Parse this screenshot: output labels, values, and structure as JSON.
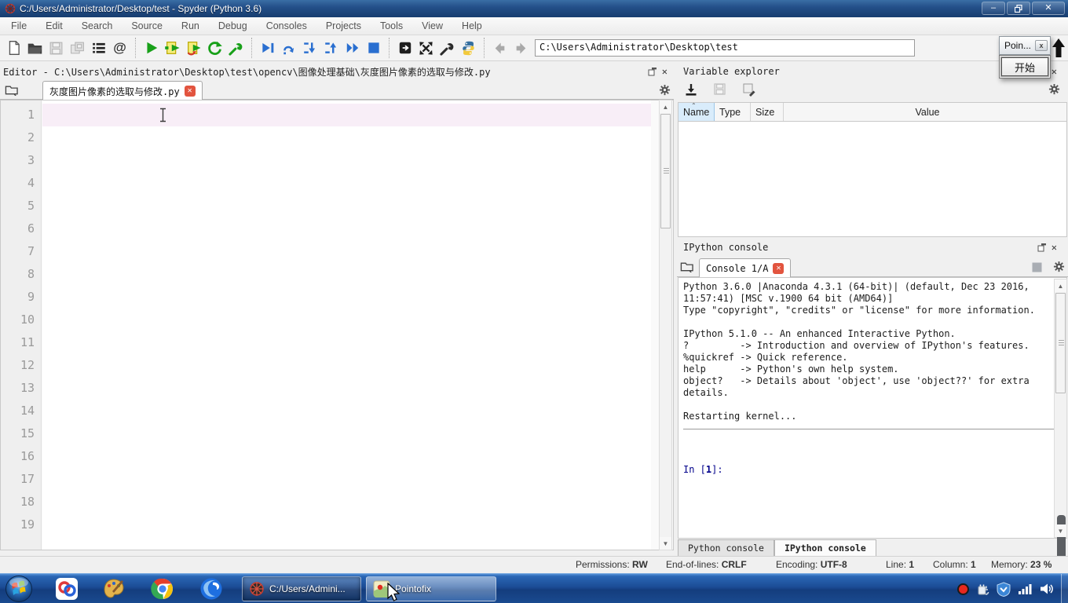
{
  "window": {
    "title": "C:/Users/Administrator/Desktop/test - Spyder (Python 3.6)",
    "controls": {
      "minimize": "–",
      "restore": "❐",
      "close": "✕"
    }
  },
  "menu": {
    "items": [
      "File",
      "Edit",
      "Search",
      "Source",
      "Run",
      "Debug",
      "Consoles",
      "Projects",
      "Tools",
      "View",
      "Help"
    ]
  },
  "toolbar": {
    "address": "C:\\Users\\Administrator\\Desktop\\test",
    "at_glyph": "@"
  },
  "pointofix": {
    "title": "Poin...",
    "close_glyph": "x",
    "start_label": "开始"
  },
  "editor": {
    "pane_title": "Editor - C:\\Users\\Administrator\\Desktop\\test\\opencv\\图像处理基础\\灰度图片像素的选取与修改.py",
    "tab_label": "灰度图片像素的选取与修改.py",
    "tab_close_glyph": "✕",
    "line_numbers": [
      "1",
      "2",
      "3",
      "4",
      "5",
      "6",
      "7",
      "8",
      "9",
      "10",
      "11",
      "12",
      "13",
      "14",
      "15",
      "16",
      "17",
      "18",
      "19"
    ],
    "current_line": "1"
  },
  "variable_explorer": {
    "pane_title": "Variable explorer",
    "columns": [
      "Name",
      "Type",
      "Size",
      "Value"
    ]
  },
  "console": {
    "pane_title": "IPython console",
    "tab_label": "Console 1/A",
    "tab_close_glyph": "✕",
    "banner_lines": [
      "Python 3.6.0 |Anaconda 4.3.1 (64-bit)| (default, Dec 23 2016,",
      "11:57:41) [MSC v.1900 64 bit (AMD64)]",
      "Type \"copyright\", \"credits\" or \"license\" for more information.",
      "",
      "IPython 5.1.0 -- An enhanced Interactive Python.",
      "?         -> Introduction and overview of IPython's features.",
      "%quickref -> Quick reference.",
      "help      -> Python's own help system.",
      "object?   -> Details about 'object', use 'object??' for extra",
      "details.",
      "",
      "Restarting kernel..."
    ],
    "prompt": {
      "prefix": "In [",
      "number": "1",
      "suffix": "]:"
    },
    "bottom_tabs": {
      "python": "Python console",
      "ipython": "IPython console"
    }
  },
  "statusbar": {
    "permissions": {
      "label": "Permissions:",
      "value": "RW"
    },
    "eol": {
      "label": "End-of-lines:",
      "value": "CRLF"
    },
    "encoding": {
      "label": "Encoding:",
      "value": "UTF-8"
    },
    "line": {
      "label": "Line:",
      "value": "1"
    },
    "column": {
      "label": "Column:",
      "value": "1"
    },
    "memory": {
      "label": "Memory:",
      "value": "23 %"
    }
  },
  "taskbar": {
    "spyder_button_label": "C:/Users/Admini...",
    "pointofix_button_label": "Pointofix"
  },
  "icons": {
    "new-file": "blank page",
    "open-file": "folder",
    "save": "floppy (disabled)",
    "save-all": "floppies (disabled)",
    "outline": "list",
    "at-symbol": "@",
    "run": "green play",
    "run-cell": "yellow cell play",
    "run-cell-advance": "cell play advance",
    "rerun": "green circular arrow",
    "configure": "green wrench",
    "debug": "blue play-pause",
    "step": "blue step",
    "step-into": "blue arrow down",
    "step-return": "blue arrow up",
    "continue": "blue double play",
    "stop": "blue square",
    "maximize-pane": "dark square arrow",
    "fullscreen": "diagonal arrows",
    "tools": "wrench",
    "python-logo": "python",
    "back": "gray left arrow",
    "forward": "gray right arrow",
    "gear": "options gear",
    "browse-tabs": "folder",
    "import-data": "down arrow into tray",
    "stop-console": "gray square"
  },
  "colors": {
    "titlebar_blue": "#24508a",
    "taskbar_blue": "#1b4c95",
    "current_line_pink": "#f8eef7",
    "tab_close_red": "#e2543f",
    "run_green": "#18a019",
    "debug_blue": "#2a6fd0",
    "prompt_navy": "#00008b",
    "name_column_selected": "#d9ecfb"
  }
}
